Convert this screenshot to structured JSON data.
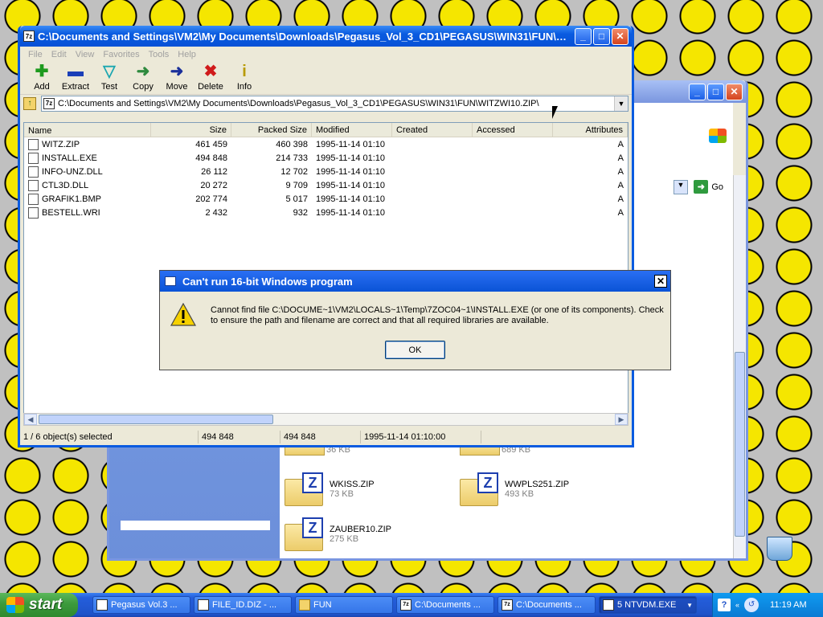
{
  "desktop": {
    "recycle_bin_label": "Recycle Bin"
  },
  "explorer": {
    "go_label": "Go",
    "tiles": [
      {
        "name": "WKISS.ZIP",
        "size": "73 KB"
      },
      {
        "name": "WWPLS251.ZIP",
        "size": "493 KB"
      },
      {
        "name": "ZAUBER10.ZIP",
        "size": "275 KB"
      }
    ],
    "partial_sizes": [
      "36 KB",
      "689 KB"
    ]
  },
  "sevenzip": {
    "title": "C:\\Documents and Settings\\VM2\\My Documents\\Downloads\\Pegasus_Vol_3_CD1\\PEGASUS\\WIN31\\FUN\\Wi...",
    "menu": [
      "File",
      "Edit",
      "View",
      "Favorites",
      "Tools",
      "Help"
    ],
    "toolbar": [
      {
        "label": "Add",
        "icon": "add-icon",
        "glyph": "✚",
        "color": "#1e9a1e"
      },
      {
        "label": "Extract",
        "icon": "extract-icon",
        "glyph": "▬",
        "color": "#1a3fb8"
      },
      {
        "label": "Test",
        "icon": "test-icon",
        "glyph": "▽",
        "color": "#1aa6b0"
      },
      {
        "label": "Copy",
        "icon": "copy-icon",
        "glyph": "➜",
        "color": "#2e8a3e"
      },
      {
        "label": "Move",
        "icon": "move-icon",
        "glyph": "➜",
        "color": "#1a2f9a"
      },
      {
        "label": "Delete",
        "icon": "delete-icon",
        "glyph": "✖",
        "color": "#d01b1b"
      },
      {
        "label": "Info",
        "icon": "info-icon",
        "glyph": "i",
        "color": "#b89a00"
      }
    ],
    "address": "C:\\Documents and Settings\\VM2\\My Documents\\Downloads\\Pegasus_Vol_3_CD1\\PEGASUS\\WIN31\\FUN\\WITZWI10.ZIP\\",
    "columns": {
      "name": "Name",
      "size": "Size",
      "packed": "Packed Size",
      "modified": "Modified",
      "created": "Created",
      "accessed": "Accessed",
      "attributes": "Attributes"
    },
    "files": [
      {
        "name": "WITZ.ZIP",
        "size": "461 459",
        "packed": "460 398",
        "modified": "1995-11-14 01:10",
        "attr": "A",
        "icon": "zip-file-icon"
      },
      {
        "name": "INSTALL.EXE",
        "size": "494 848",
        "packed": "214 733",
        "modified": "1995-11-14 01:10",
        "attr": "A",
        "icon": "exe-file-icon"
      },
      {
        "name": "INFO-UNZ.DLL",
        "size": "26 112",
        "packed": "12 702",
        "modified": "1995-11-14 01:10",
        "attr": "A",
        "icon": "dll-file-icon"
      },
      {
        "name": "CTL3D.DLL",
        "size": "20 272",
        "packed": "9 709",
        "modified": "1995-11-14 01:10",
        "attr": "A",
        "icon": "dll-file-icon"
      },
      {
        "name": "GRAFIK1.BMP",
        "size": "202 774",
        "packed": "5 017",
        "modified": "1995-11-14 01:10",
        "attr": "A",
        "icon": "bmp-file-icon"
      },
      {
        "name": "BESTELL.WRI",
        "size": "2 432",
        "packed": "932",
        "modified": "1995-11-14 01:10",
        "attr": "A",
        "icon": "wri-file-icon"
      }
    ],
    "status": {
      "selected": "1 / 6 object(s) selected",
      "size": "494 848",
      "packed": "494 848",
      "modified": "1995-11-14 01:10:00"
    }
  },
  "dialog": {
    "title": "Can't run 16-bit Windows program",
    "message": "Cannot find file C:\\DOCUME~1\\VM2\\LOCALS~1\\Temp\\7ZOC04~1\\INSTALL.EXE (or one of its components). Check to ensure the path and filename are correct and that all required libraries are available.",
    "ok_label": "OK"
  },
  "taskbar": {
    "start_label": "start",
    "tasks": [
      {
        "label": "Pegasus Vol.3 ...",
        "icon": "browser-icon"
      },
      {
        "label": "FILE_ID.DIZ - ...",
        "icon": "notepad-icon"
      },
      {
        "label": "FUN",
        "icon": "folder-icon"
      },
      {
        "label": "C:\\Documents ...",
        "icon": "7zip-icon"
      },
      {
        "label": "C:\\Documents ...",
        "icon": "7zip-icon"
      },
      {
        "label": "5 NTVDM.EXE",
        "icon": "ntvdm-icon"
      }
    ],
    "clock": "11:19 AM"
  }
}
